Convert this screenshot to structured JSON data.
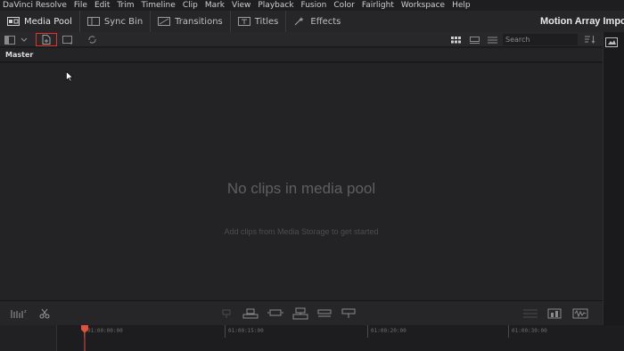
{
  "menu": {
    "items": [
      "DaVinci Resolve",
      "File",
      "Edit",
      "Trim",
      "Timeline",
      "Clip",
      "Mark",
      "View",
      "Playback",
      "Fusion",
      "Color",
      "Fairlight",
      "Workspace",
      "Help"
    ]
  },
  "toolbar": {
    "media_pool": "Media Pool",
    "sync_bin": "Sync Bin",
    "transitions": "Transitions",
    "titles": "Titles",
    "effects": "Effects",
    "project_title": "Motion Array Impo"
  },
  "search": {
    "placeholder": "Search"
  },
  "bin": {
    "name": "Master"
  },
  "media_pool": {
    "empty_title": "No clips in media pool",
    "empty_subtitle": "Add clips from Media Storage to get started"
  },
  "timeline": {
    "timecodes": [
      "01:00:00:00",
      "01:00:15:00",
      "01:00:20:00",
      "01:00:30:00"
    ]
  },
  "colors": {
    "highlight": "#e0322f",
    "playhead": "#e0503a",
    "background": "#1c1c1e"
  }
}
